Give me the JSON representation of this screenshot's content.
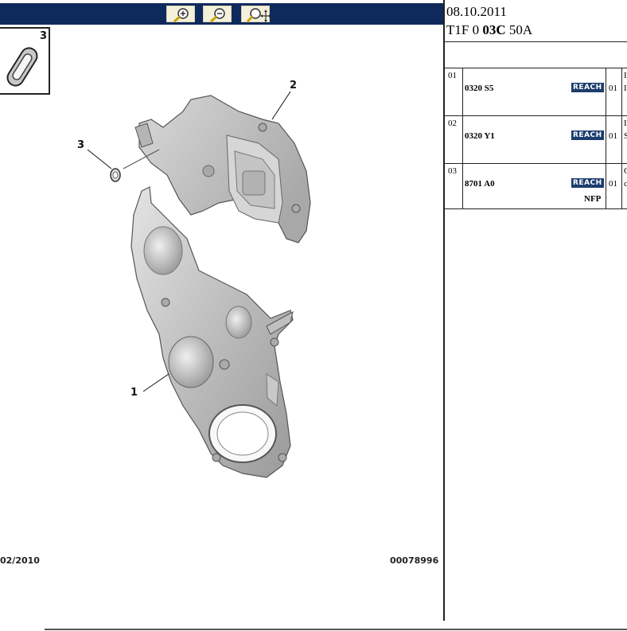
{
  "toolbar": {
    "buttons": [
      {
        "icon": "zoom-in-icon"
      },
      {
        "icon": "zoom-out-icon"
      },
      {
        "icon": "zoom-pan-icon"
      }
    ]
  },
  "diagram": {
    "inset_label": "3",
    "callouts": [
      "1",
      "2",
      "3"
    ],
    "footer_left": "02/2010",
    "footer_right": "00078996"
  },
  "header": {
    "date": "08.10.2011",
    "code_prefix": "T1F 0 ",
    "code_bold": "03C",
    "code_suffix": " 50A"
  },
  "parts": [
    {
      "num": "01",
      "ref": "0320 S5",
      "badge": "REACH",
      "qty": "01",
      "cut_top": "I",
      "cut_mid": "I"
    },
    {
      "num": "02",
      "ref": "0320 Y1",
      "badge": "REACH",
      "qty": "01",
      "cut_top": "I",
      "cut_mid": "S"
    },
    {
      "num": "03",
      "ref": "8701 A0",
      "badge": "REACH",
      "qty": "01",
      "cut_top": "C",
      "cut_mid": "c",
      "extra": "NFP"
    }
  ],
  "colors": {
    "toolbar": "#0e2a5c",
    "badge": "#1d3d6e",
    "button": "#f3f0dc"
  }
}
